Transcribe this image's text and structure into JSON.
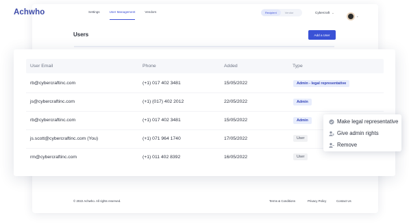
{
  "brand": {
    "name": "Achwho"
  },
  "nav": {
    "items": [
      "Settings",
      "User Management",
      "Vendors"
    ]
  },
  "mode_toggle": {
    "active": "Recipient",
    "inactive": "Vendor"
  },
  "company": {
    "name": "Cybercraft"
  },
  "page": {
    "title": "Users",
    "add_button": "Add a User"
  },
  "table": {
    "columns": [
      "User Email",
      "Phone",
      "Added",
      "Type"
    ],
    "rows": [
      {
        "email": "rb@cybercraftinc.com",
        "phone": "(+1) 017 402 3481",
        "added": "15/05/2022",
        "type": "Admin - legal representative"
      },
      {
        "email": "js@cybercraftinc.com",
        "phone": "(+1) (017) 402 2012",
        "added": "22/05/2022",
        "type": "Admin"
      },
      {
        "email": "rb@cybercraftinc.com",
        "phone": "(+1) 017 402 3481",
        "added": "15/05/2022",
        "type": "Admin"
      },
      {
        "email": "js.scott@cybercraftinc.com (You)",
        "phone": "(+1) 071 964 1740",
        "added": "17/05/2022",
        "type": "User"
      },
      {
        "email": "rm@cybercraftinc.com",
        "phone": "(+1) 011 402 8392",
        "added": "16/05/2022",
        "type": "User"
      }
    ]
  },
  "context_menu": {
    "items": [
      {
        "label": "Make legal representative",
        "icon": "check-circle-icon"
      },
      {
        "label": "Give admin rights",
        "icon": "user-shield-icon"
      },
      {
        "label": "Remove",
        "icon": "user-remove-icon"
      }
    ]
  },
  "footer": {
    "copyright": "© 2022 Achwho. All rights reserved.",
    "links": [
      "Terms & Conditions",
      "Privacy Policy",
      "Contact Us"
    ]
  },
  "colors": {
    "accent": "#3a52d6",
    "badge_admin_bg": "#e8edfc"
  }
}
